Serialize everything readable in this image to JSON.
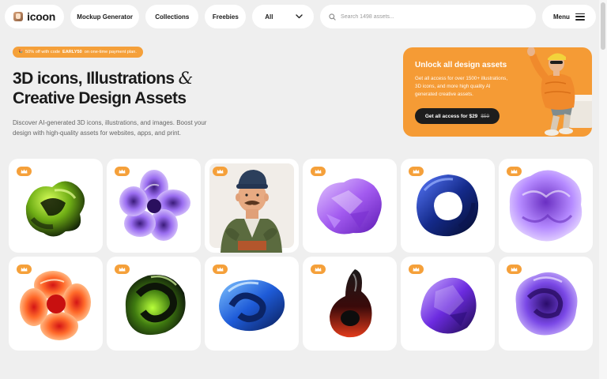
{
  "nav": {
    "logo_text": "icoon",
    "mockup_label": "Mockup Generator",
    "collections_label": "Collections",
    "freebies_label": "Freebies",
    "filter_selected": "All",
    "search_placeholder": "Search 1498 assets...",
    "menu_label": "Menu"
  },
  "hero": {
    "promo_prefix": "50% off with code",
    "promo_code": "EARLY50",
    "promo_suffix": "on one-time payment plan.",
    "headline_line1": "3D icons, Illustrations",
    "headline_amp": "&",
    "headline_line2": "Creative Design Assets",
    "description": "Discover AI-generated 3D icons, illustrations, and images. Boost your design with high-quality assets for websites, apps, and print."
  },
  "cta": {
    "title": "Unlock all design assets",
    "text": "Get all access for over 1500+ illustrations, 3D icons, and more high quality AI generated creative assets.",
    "button_label": "Get all access for $29",
    "old_price": "$59"
  },
  "colors": {
    "accent": "#f59b35",
    "background": "#efefef",
    "card": "#ffffff",
    "dark": "#1d1d1d"
  },
  "assets": [
    {
      "name": "green-glass-knot",
      "premium": true
    },
    {
      "name": "purple-glass-flower",
      "premium": true
    },
    {
      "name": "mustache-man-character",
      "premium": true
    },
    {
      "name": "purple-crystal-blob",
      "premium": true
    },
    {
      "name": "blue-dark-ring",
      "premium": true
    },
    {
      "name": "purple-ruffle-flower",
      "premium": true
    },
    {
      "name": "orange-red-flower",
      "premium": true
    },
    {
      "name": "green-black-swirl",
      "premium": true
    },
    {
      "name": "blue-glossy-knot",
      "premium": true
    },
    {
      "name": "red-black-loop",
      "premium": true
    },
    {
      "name": "purple-gem",
      "premium": true
    },
    {
      "name": "violet-crumpled-blob",
      "premium": true
    }
  ]
}
